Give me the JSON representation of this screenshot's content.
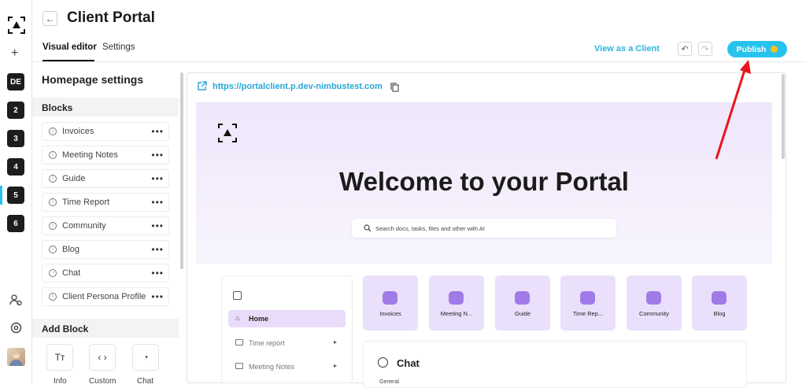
{
  "header": {
    "title": "Client Portal"
  },
  "tabs": [
    {
      "label": "Visual editor"
    },
    {
      "label": "Settings"
    }
  ],
  "toolbar": {
    "view_as_client": "View as a Client",
    "publish": "Publish"
  },
  "rail": {
    "workspaces": [
      "DE",
      "2",
      "3",
      "4",
      "5",
      "6"
    ],
    "add": "+"
  },
  "sidebar": {
    "title": "Homepage settings",
    "blocks_header": "Blocks",
    "blocks": [
      "Invoices",
      "Meeting Notes",
      "Guide",
      "Time Report",
      "Community",
      "Blog",
      "Chat",
      "Client Persona Profile"
    ],
    "add_block_header": "Add Block",
    "add_block_items": [
      {
        "label": "Info",
        "glyph": "Tт"
      },
      {
        "label": "Custom",
        "glyph": "‹ ›"
      },
      {
        "label": "Chat",
        "glyph": "◔"
      }
    ]
  },
  "preview": {
    "url": "https://portalclient.p.dev-nimbustest.com",
    "welcome": "Welcome to your Portal",
    "search_placeholder": "Search docs, tasks, files and other with AI",
    "nav": [
      {
        "label": "Home"
      },
      {
        "label": "Time report"
      },
      {
        "label": "Meeting Notes"
      }
    ],
    "cards": [
      "Invoices",
      "Meeting N...",
      "Guide",
      "Time Rep...",
      "Community",
      "Blog"
    ],
    "chat_title": "Chat",
    "chat_sub": "General"
  },
  "colors": {
    "accent": "#27c3ee",
    "publish_dot": "#f6c21c",
    "hero": "#efe6fb",
    "card": "#eae0fb",
    "arrow": "#e8161b"
  }
}
